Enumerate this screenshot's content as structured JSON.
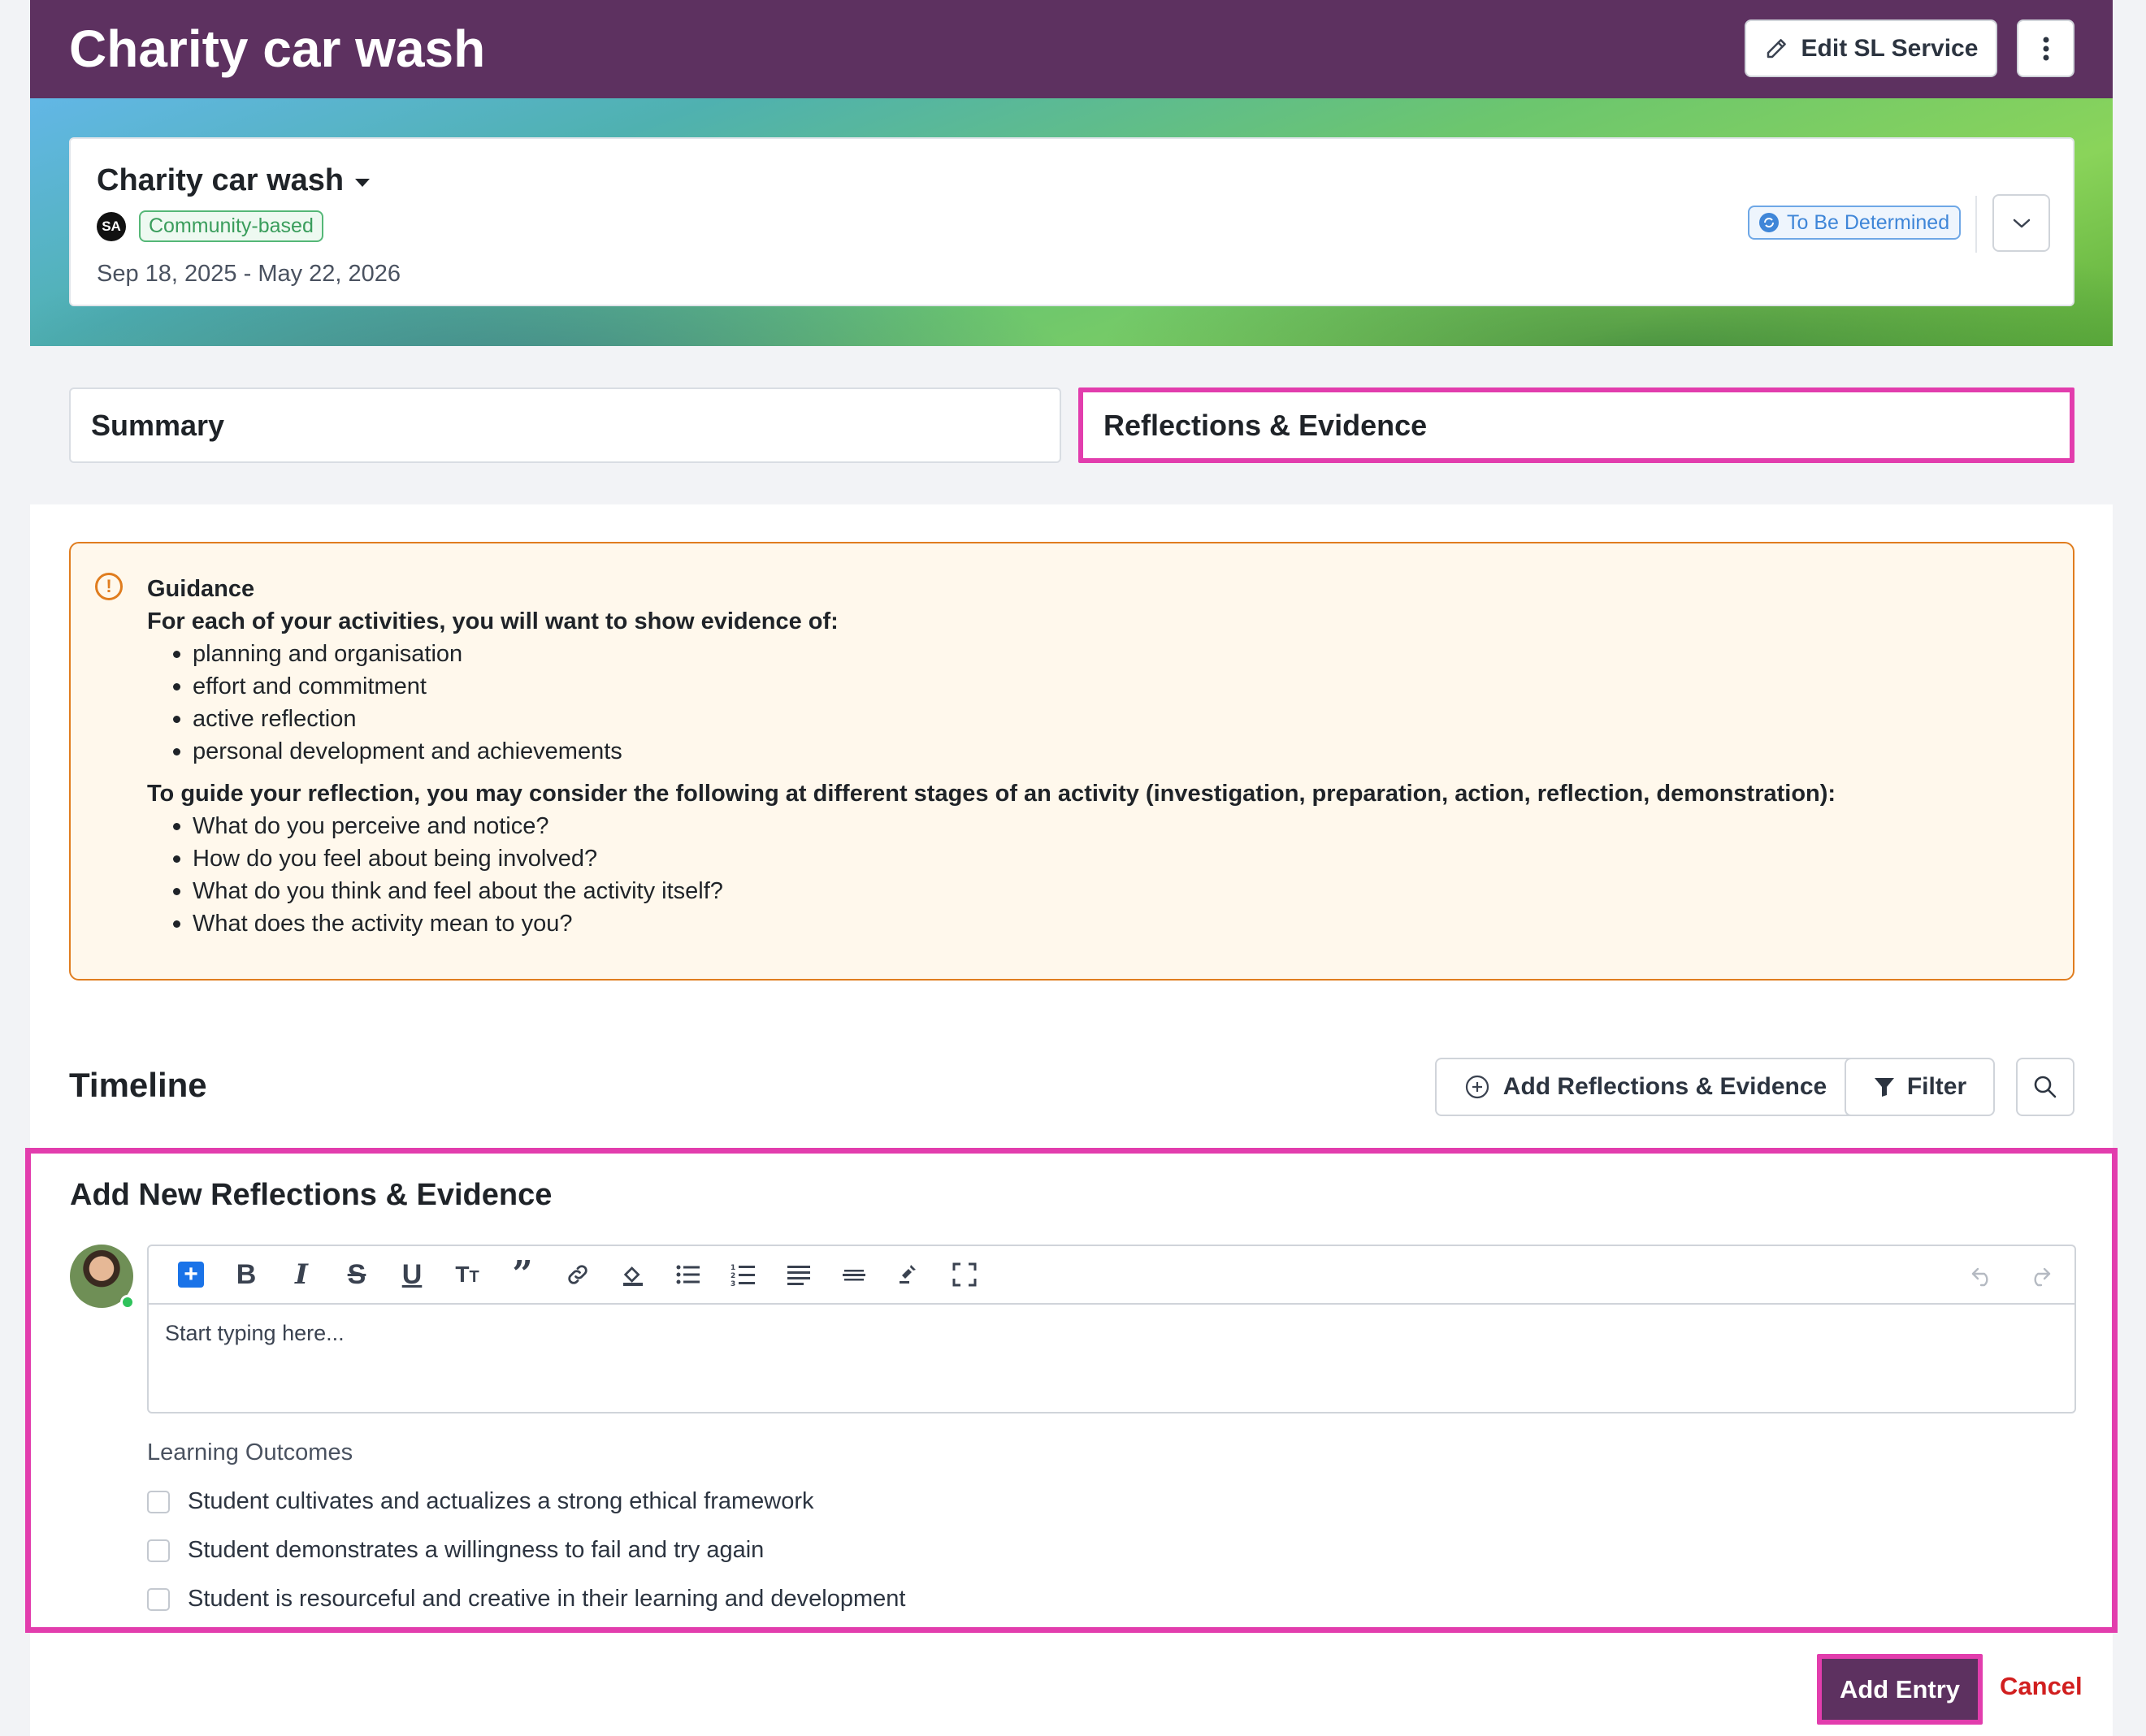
{
  "header": {
    "title": "Charity car wash",
    "edit_button_label": "Edit SL Service",
    "more_icon": "vertical-ellipsis"
  },
  "service_card": {
    "title": "Charity car wash",
    "avatar_initials": "SA",
    "category_tag": "Community-based",
    "dates": "Sep 18, 2025 - May 22, 2026",
    "status_tag": "To Be Determined"
  },
  "tabs": [
    {
      "label": "Summary",
      "selected": false
    },
    {
      "label": "Reflections & Evidence",
      "selected": true
    }
  ],
  "guidance": {
    "title": "Guidance",
    "intro_1": "For each of your activities, you will want to show evidence of:",
    "list_1": [
      "planning and organisation",
      "effort and commitment",
      "active reflection",
      "personal development and achievements"
    ],
    "intro_2": "To guide your reflection, you may consider the following at different stages of an activity (investigation, preparation, action, reflection, demonstration):",
    "list_2": [
      "What do you perceive and notice?",
      "How do you feel about being involved?",
      "What do you think and feel about the activity itself?",
      "What does the activity mean to you?"
    ]
  },
  "timeline": {
    "title": "Timeline",
    "add_button_label": "Add Reflections & Evidence",
    "filter_button_label": "Filter"
  },
  "new_entry": {
    "title": "Add New Reflections & Evidence",
    "editor_placeholder": "Start typing here...",
    "learning_outcomes_label": "Learning Outcomes",
    "outcomes": [
      {
        "label": "Student cultivates and actualizes a strong ethical framework",
        "checked": false
      },
      {
        "label": "Student demonstrates a willingness to fail and try again",
        "checked": false
      },
      {
        "label": "Student is resourceful and creative in their learning and development",
        "checked": false
      }
    ]
  },
  "actions": {
    "add_entry_label": "Add Entry",
    "cancel_label": "Cancel"
  },
  "colors": {
    "header_bg": "#5d3160",
    "highlight": "#e23dad",
    "cancel": "#d11f1f",
    "guidance_border": "#e07d1f",
    "community_tag": "#3a9d5c",
    "status_tag": "#3f86d8"
  }
}
